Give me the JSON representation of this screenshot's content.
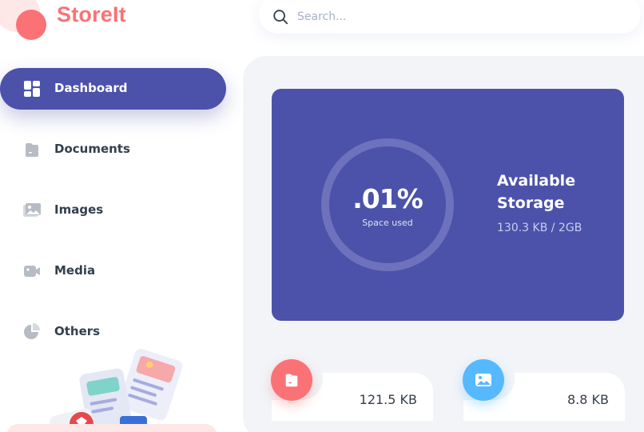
{
  "app": {
    "name": "StoreIt"
  },
  "search": {
    "placeholder": "Search...",
    "value": ""
  },
  "sidebar": {
    "items": [
      {
        "label": "Dashboard",
        "icon": "dashboard-icon",
        "active": true
      },
      {
        "label": "Documents",
        "icon": "documents-icon",
        "active": false
      },
      {
        "label": "Images",
        "icon": "images-icon",
        "active": false
      },
      {
        "label": "Media",
        "icon": "media-icon",
        "active": false
      },
      {
        "label": "Others",
        "icon": "others-icon",
        "active": false
      }
    ]
  },
  "storage": {
    "percent_label": ".01%",
    "percent_value": 0.01,
    "space_used_label": "Space used",
    "title": "Available Storage",
    "used_value": "130.3 KB / 2GB"
  },
  "summary": [
    {
      "icon": "document-icon",
      "size": "121.5 KB",
      "color": "#fa7275"
    },
    {
      "icon": "image-icon",
      "size": "8.8 KB",
      "color": "#56b8ff"
    }
  ],
  "colors": {
    "brand": "#fa7275",
    "primary": "#4c52aa",
    "panel": "#f2f4f8",
    "text": "#333f4e",
    "accent_blue": "#56b8ff"
  }
}
